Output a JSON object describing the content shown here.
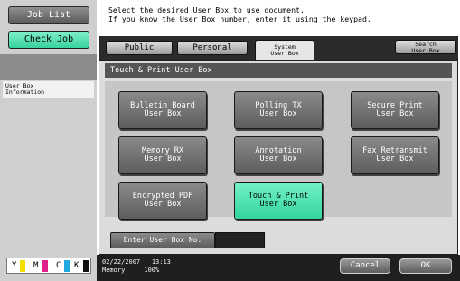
{
  "left": {
    "job_list": "Job List",
    "check_job": "Check Job",
    "user_box_info_line1": "User Box",
    "user_box_info_line2": "Information"
  },
  "toner": [
    {
      "letter": "Y",
      "color": "#f4e000"
    },
    {
      "letter": "M",
      "color": "#e0208a"
    },
    {
      "letter": "C",
      "color": "#20a8e0"
    },
    {
      "letter": "K",
      "color": "#111111"
    }
  ],
  "message": {
    "line1": "Select the desired User Box to use document.",
    "line2": "If you know the User Box number, enter it using the keypad."
  },
  "tabs": {
    "public": "Public",
    "personal": "Personal",
    "system_line1": "System",
    "system_line2": "User Box",
    "search_line1": "Search",
    "search_line2": "User Box"
  },
  "panel": {
    "title": "Touch & Print User Box",
    "buttons": [
      {
        "line1": "Bulletin Board",
        "line2": "User Box",
        "selected": false
      },
      {
        "line1": "Polling TX",
        "line2": "User Box",
        "selected": false
      },
      {
        "line1": "Secure Print",
        "line2": "User Box",
        "selected": false
      },
      {
        "line1": "Memory RX",
        "line2": "User Box",
        "selected": false
      },
      {
        "line1": "Annotation",
        "line2": "User Box",
        "selected": false
      },
      {
        "line1": "Fax Retransmit",
        "line2": "User Box",
        "selected": false
      },
      {
        "line1": "Encrypted PDF",
        "line2": "User Box",
        "selected": false
      },
      {
        "line1": "Touch & Print",
        "line2": "User Box",
        "selected": true
      }
    ],
    "enter_label": "Enter User Box No.",
    "enter_value": ""
  },
  "status": {
    "date": "02/22/2007",
    "time": "13:13",
    "memory_label": "Memory",
    "memory_value": "100%"
  },
  "actions": {
    "cancel": "Cancel",
    "ok": "OK"
  },
  "colors": {
    "accent_selected": "#33d59c",
    "button_gray": "#6f6f6f"
  }
}
